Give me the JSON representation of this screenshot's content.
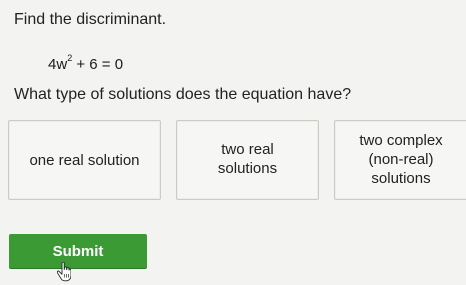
{
  "prompt": "Find the discriminant.",
  "equation": {
    "before_exp": "4w",
    "exponent": "2",
    "after_exp": " + 6 = 0"
  },
  "question": "What type of solutions does the equation have?",
  "choices": [
    {
      "label_lines": [
        "one real solution"
      ]
    },
    {
      "label_lines": [
        "two real",
        "solutions"
      ]
    },
    {
      "label_lines": [
        "two complex",
        "(non-real)",
        "solutions"
      ]
    }
  ],
  "submit_label": "Submit",
  "cursor_icon": "hand-pointer-icon",
  "colors": {
    "submit": "#3b9a33",
    "background": "#f3f4f1"
  }
}
